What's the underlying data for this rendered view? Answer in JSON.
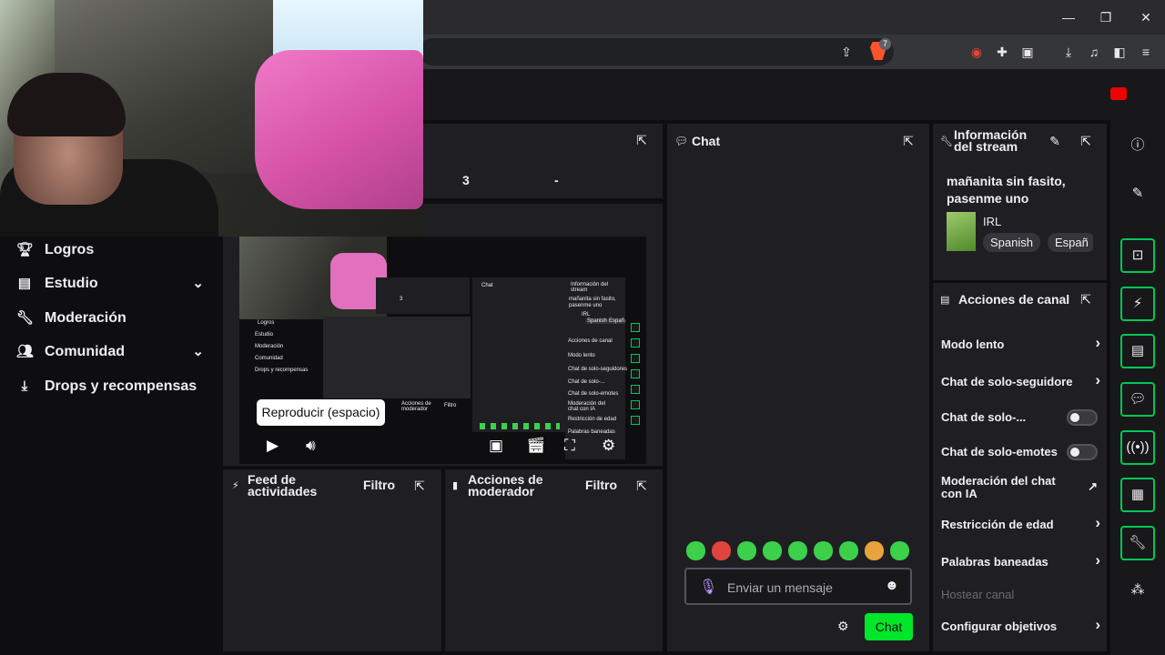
{
  "browser": {
    "window_controls": [
      "minimize",
      "maximize",
      "close"
    ],
    "brave_badge": "7"
  },
  "nav": {
    "items": [
      {
        "label": "Logros",
        "icon": "trophy-icon"
      },
      {
        "label": "Estudio",
        "icon": "studio-icon",
        "expandable": true
      },
      {
        "label": "Moderación",
        "icon": "wrench-icon"
      },
      {
        "label": "Comunidad",
        "icon": "community-icon",
        "expandable": true
      },
      {
        "label": "Drops y recompensas",
        "icon": "drops-icon"
      }
    ]
  },
  "stats": {
    "value_a": "3",
    "value_b": "-"
  },
  "preview": {
    "tooltip": "Reproducir (espacio)",
    "mini": {
      "nav": [
        "Logros",
        "Estudio",
        "Moderación",
        "Comunidad",
        "Drops y recompensas"
      ],
      "chat_title": "Chat",
      "info_title": "Información del stream",
      "stream_title": "mañanita sin fasito, pasenme uno",
      "category": "IRL",
      "tags": [
        "Spanish",
        "Españ"
      ],
      "actions_title": "Acciones de canal",
      "actions": [
        "Modo lento",
        "Chat de solo-seguidores",
        "Chat de solo-...",
        "Chat de solo-emotes",
        "Moderación del chat con IA",
        "Restricción de edad",
        "Palabras baneadas"
      ],
      "stat_value": "3",
      "feed_title": "Acciones de moderador",
      "filter": "Filtro"
    }
  },
  "feed": {
    "title": "Feed de actividades",
    "filter": "Filtro"
  },
  "mod_actions": {
    "title": "Acciones de moderador",
    "filter": "Filtro"
  },
  "chat": {
    "title": "Chat",
    "input_placeholder": "Enviar un mensaje",
    "send_label": "Chat",
    "emotes": [
      "#3bd14a",
      "#e0443e",
      "#3bd14a",
      "#3bd14a",
      "#3bd14a",
      "#3bd14a",
      "#3bd14a",
      "#e9a33a",
      "#3bd14a"
    ]
  },
  "stream_info": {
    "title": "Información del stream",
    "stream_title": "mañanita sin fasito, pasenme uno",
    "category": "IRL",
    "tags": [
      "Spanish",
      "Españ"
    ]
  },
  "channel_actions": {
    "title": "Acciones de canal",
    "items": [
      {
        "label": "Modo lento",
        "control": "arrow"
      },
      {
        "label": "Chat de solo-seguidore",
        "control": "arrow"
      },
      {
        "label": "Chat de solo-...",
        "control": "toggle",
        "on": false
      },
      {
        "label": "Chat de solo-emotes",
        "control": "toggle",
        "on": false
      },
      {
        "label": "Moderación del chat con IA",
        "control": "external"
      },
      {
        "label": "Restricción de edad",
        "control": "arrow"
      },
      {
        "label": "Palabras baneadas",
        "control": "arrow"
      },
      {
        "label": "Hostear canal",
        "control": "none",
        "disabled": true
      },
      {
        "label": "Configurar objetivos",
        "control": "arrow"
      }
    ]
  },
  "rail": {
    "icons": [
      "info-icon",
      "edit-icon",
      "screenshot-icon",
      "lightning-icon",
      "notes-icon",
      "chat-bubble-icon",
      "broadcast-icon",
      "layout-icon",
      "wrench-icon",
      "community-icon"
    ]
  },
  "colors": {
    "accent": "#00c853",
    "button": "#00e629",
    "live": "#eb0400",
    "panel": "#1f1f23"
  }
}
